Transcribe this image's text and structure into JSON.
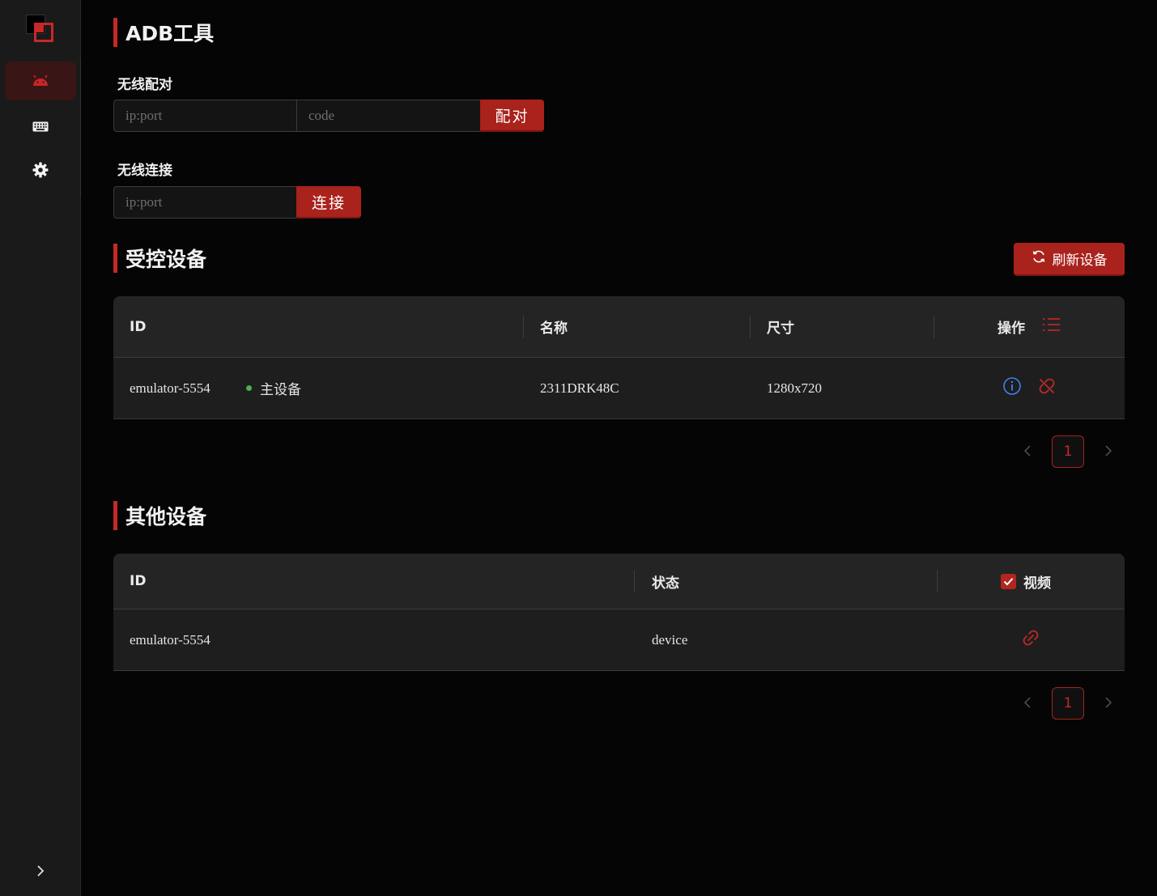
{
  "app": {
    "page_title": "ADB工具"
  },
  "sidebar": {
    "items": [
      {
        "icon": "android-icon",
        "active": true
      },
      {
        "icon": "keyboard-icon",
        "active": false
      },
      {
        "icon": "gear-icon",
        "active": false
      }
    ],
    "expand_icon": "chevron-right-icon"
  },
  "pairing": {
    "label": "无线配对",
    "ip_placeholder": "ip:port",
    "code_placeholder": "code",
    "button": "配对"
  },
  "connect": {
    "label": "无线连接",
    "ip_placeholder": "ip:port",
    "button": "连接"
  },
  "controlled": {
    "title": "受控设备",
    "refresh_button": "刷新设备",
    "headers": {
      "id": "ID",
      "name": "名称",
      "size": "尺寸",
      "actions": "操作"
    },
    "rows": [
      {
        "id": "emulator-5554",
        "badge": "主设备",
        "name": "2311DRK48C",
        "size": "1280x720"
      }
    ],
    "page": "1"
  },
  "others": {
    "title": "其他设备",
    "headers": {
      "id": "ID",
      "status": "状态",
      "video": "视频"
    },
    "video_checked": true,
    "rows": [
      {
        "id": "emulator-5554",
        "status": "device"
      }
    ],
    "page": "1"
  },
  "colors": {
    "accent": "#a9221c",
    "accent_bright": "#c62828",
    "info_blue": "#3b82f6",
    "online_green": "#4caf50"
  }
}
